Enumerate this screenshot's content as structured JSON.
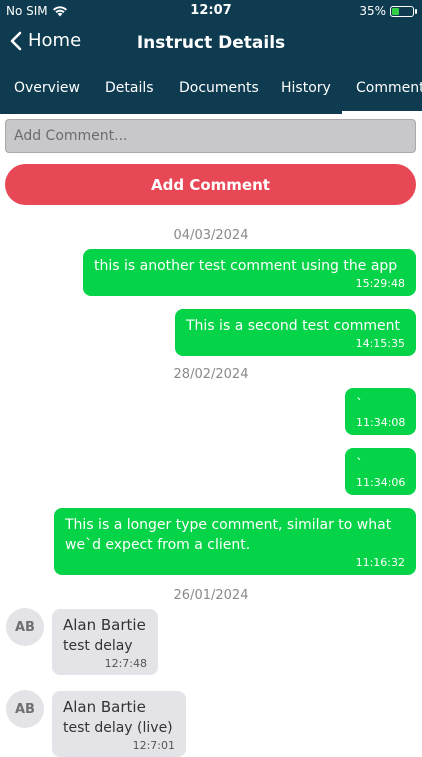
{
  "status": {
    "carrier": "No SIM",
    "time": "12:07",
    "battery": "35%",
    "battery_level": 0.35
  },
  "nav": {
    "back_label": "Home",
    "title": "Instruct Details"
  },
  "tabs": [
    "Overview",
    "Details",
    "Documents",
    "History",
    "Comments"
  ],
  "active_tab": "Comments",
  "composer": {
    "placeholder": "Add Comment...",
    "value": "",
    "button_label": "Add Comment"
  },
  "colors": {
    "header": "#0e3b4f",
    "outgoing_bubble": "#05d348",
    "incoming_bubble": "#e4e4e8",
    "add_button": "#e84855"
  },
  "messages": {
    "date1": "04/03/2024",
    "m1": {
      "text": "this is another test comment using the app",
      "time": "15:29:48"
    },
    "m2": {
      "text": "This is a second test comment",
      "time": "14:15:35"
    },
    "date2": "28/02/2024",
    "m3": {
      "text": "`",
      "time": "11:34:08"
    },
    "m4": {
      "text": "`",
      "time": "11:34:06"
    },
    "m5": {
      "text": "This is a longer type comment, similar to what we`d expect from a client.",
      "time": "11:16:32"
    },
    "date3": "26/01/2024",
    "m6": {
      "initials": "AB",
      "sender": "Alan Bartie",
      "text": "test delay",
      "time": "12:7:48"
    },
    "m7": {
      "initials": "AB",
      "sender": "Alan Bartie",
      "text": "test delay (live)",
      "time": "12:7:01"
    }
  }
}
